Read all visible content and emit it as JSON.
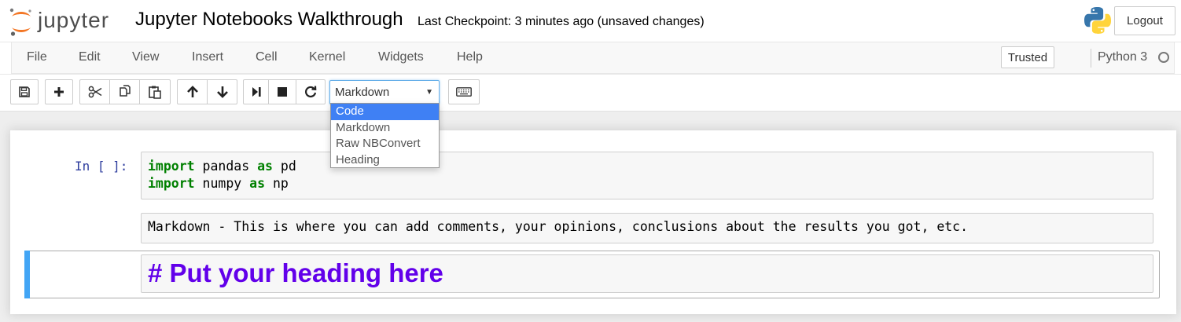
{
  "header": {
    "logo_text": "jupyter",
    "notebook_title": "Jupyter Notebooks Walkthrough",
    "checkpoint": "Last Checkpoint: 3 minutes ago (unsaved changes)",
    "logout_label": "Logout"
  },
  "menubar": {
    "items": [
      "File",
      "Edit",
      "View",
      "Insert",
      "Cell",
      "Kernel",
      "Widgets",
      "Help"
    ],
    "trusted_label": "Trusted",
    "kernel_name": "Python 3"
  },
  "toolbar": {
    "buttons": [
      "save-icon",
      "plus-icon",
      "cut-icon",
      "copy-icon",
      "paste-icon",
      "arrow-up-icon",
      "arrow-down-icon",
      "run-icon",
      "stop-icon",
      "restart-icon",
      "keyboard-icon"
    ],
    "cell_type_value": "Markdown",
    "cell_type_options": [
      "Code",
      "Markdown",
      "Raw NBConvert",
      "Heading"
    ],
    "highlighted_option": "Code"
  },
  "cells": {
    "code_cell": {
      "prompt": "In [ ]:",
      "lines": [
        {
          "kw1": "import",
          "mod": " pandas ",
          "kw2": "as",
          "alias": " pd"
        },
        {
          "kw1": "import",
          "mod": " numpy ",
          "kw2": "as",
          "alias": " np"
        }
      ]
    },
    "markdown_cell": {
      "text": "Markdown - This is where you can add comments, your opinions, conclusions about the results you got, etc."
    },
    "heading_cell": {
      "text": "# Put your heading here"
    }
  },
  "colors": {
    "accent": "#42a5f5",
    "heading": "#6200ea",
    "keyword": "#008000",
    "prompt": "#303f9f",
    "dropdown_highlight": "#3f80f4"
  }
}
